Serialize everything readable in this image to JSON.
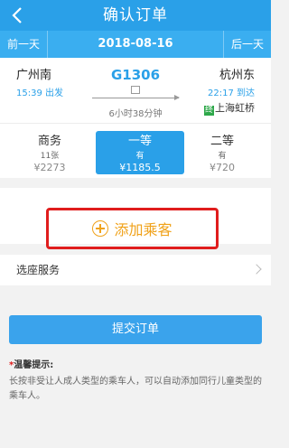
{
  "header": {
    "title": "确认订单",
    "back_icon": "chevron-left-icon"
  },
  "datebar": {
    "prev_label": "前一天",
    "date": "2018-08-16",
    "next_label": "后一天"
  },
  "train": {
    "from_station": "广州南",
    "from_time": "15:39 出发",
    "train_no": "G1306",
    "duration": "6小时38分钟",
    "to_station": "杭州东",
    "to_time": "22:17 到达",
    "via_badge": "终",
    "via_station": "上海虹桥"
  },
  "seats": [
    {
      "name": "商务",
      "avail": "11张",
      "price": "¥2273"
    },
    {
      "name": "一等",
      "avail": "有",
      "price": "¥1185.5"
    },
    {
      "name": "二等",
      "avail": "有",
      "price": "¥720"
    }
  ],
  "add_passenger": {
    "label": "添加乘客"
  },
  "service": {
    "label": "选座服务"
  },
  "submit": {
    "label": "提交订单"
  },
  "tips": {
    "star": "*",
    "title": "温馨提示:",
    "body": "长按非受让人成人类型的乘车人，可以自动添加同行儿童类型的乘车人。"
  },
  "colors": {
    "accent": "#2aa0e8",
    "highlight_border": "#e01d1d",
    "add_text": "#f0a21a"
  }
}
